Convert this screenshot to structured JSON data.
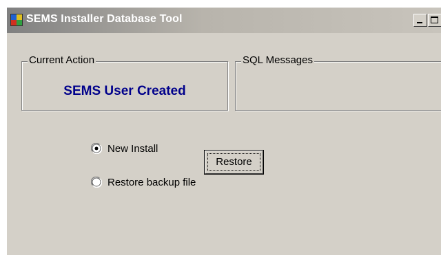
{
  "window": {
    "title": "SEMS Installer Database Tool",
    "icon": "app-window-icon",
    "controls": [
      "minimize-icon",
      "maximize-icon"
    ]
  },
  "current_action": {
    "label": "Current Action",
    "value": "SEMS User Created",
    "value_color": "#00008b"
  },
  "sql_messages": {
    "label": "SQL Messages",
    "value": ""
  },
  "options": [
    {
      "label": "New Install",
      "selected": true
    },
    {
      "label": "Restore backup file",
      "selected": false
    }
  ],
  "restore_button": {
    "label": "Restore"
  },
  "colors": {
    "window_bg": "#d4d0c8",
    "title_text": "#ffffff"
  }
}
